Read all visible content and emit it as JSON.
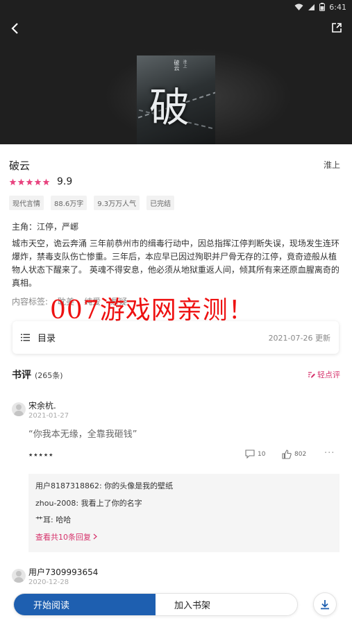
{
  "status_bar": {
    "time": "6:41"
  },
  "cover": {
    "title_char": "破",
    "side_text": "破云",
    "side_small": "淮上"
  },
  "book": {
    "title": "破云",
    "author": "淮上",
    "rating": "9.9",
    "stars": 5,
    "tags": [
      "现代言情",
      "88.6万字",
      "9.3万万人气",
      "已完结"
    ],
    "protagonist": "主角：江停，严峫",
    "description": "城市天空，诡云奔涌 三年前恭州市的缉毒行动中，因总指挥江停判断失误，现场发生连环爆炸，禁毒支队伤亡惨重。三年后，本应早已因过殉职并尸骨无存的江停，竟奇迹般从植物人状态下醒来了。 英魂不得安息，他必须从地狱重返人间，倾其所有来还原血腥离奇的真相。",
    "content_tags_label": "内容标签:",
    "content_tags": [
      "耽美",
      "纯爱",
      "悬疑"
    ]
  },
  "watermark": "007游戏网亲测！",
  "toc": {
    "label": "目录",
    "date": "2021-07-26 更新"
  },
  "reviews": {
    "title": "书评",
    "count": "(265条)",
    "light_review_label": "轻点评",
    "items": [
      {
        "user": "宋余杭.",
        "date": "2021-01-27",
        "quote": "“你我本无缘，全靠我砸钱”",
        "stars": "★★★★★",
        "comments": "10",
        "likes": "802",
        "more": "···",
        "replies": [
          "用户8187318862: 你的头像是我的壁纸",
          "zhou-2008: 我看上了你的名字",
          "艹耳: 哈哈"
        ],
        "view_more": "查看共10条回复"
      },
      {
        "user": "用户7309993654",
        "date": "2020-12-28"
      }
    ]
  },
  "bottom": {
    "read_label": "开始阅读",
    "shelf_label": "加入书架"
  },
  "colors": {
    "accent_pink": "#d6336c",
    "primary_blue": "#1e5fb0",
    "watermark_red": "#ee1111"
  }
}
